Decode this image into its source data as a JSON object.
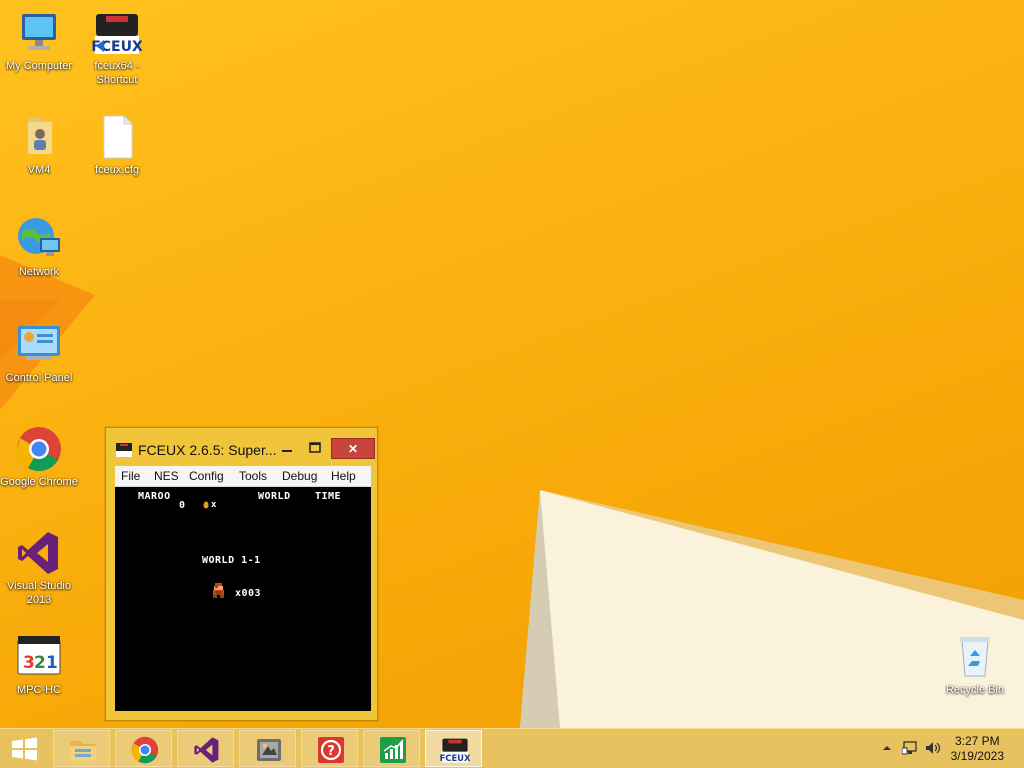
{
  "desktop": {
    "icons": [
      {
        "label": "My Computer",
        "icon": "computer-icon"
      },
      {
        "label": "fceux64 - Shortcut",
        "icon": "fceux-icon"
      },
      {
        "label": "VM4",
        "icon": "folder-icon"
      },
      {
        "label": "fceux.cfg",
        "icon": "file-icon"
      },
      {
        "label": "Network",
        "icon": "network-icon"
      },
      {
        "label": "Control Panel",
        "icon": "control-panel-icon"
      },
      {
        "label": "Google Chrome",
        "icon": "chrome-icon"
      },
      {
        "label": "Visual Studio 2013",
        "icon": "visual-studio-icon"
      },
      {
        "label": "MPC-HC",
        "icon": "mpc-hc-icon"
      },
      {
        "label": "Recycle Bin",
        "icon": "recycle-bin-icon"
      }
    ]
  },
  "window": {
    "title": "FCEUX 2.6.5: Super...",
    "close_glyph": "✕",
    "menu": [
      "File",
      "NES",
      "Config",
      "Tools",
      "Debug",
      "Help"
    ],
    "game": {
      "player_name": "MAROO",
      "score": "0",
      "coin_x": "x",
      "world_header": "WORLD",
      "time_header": "TIME",
      "world_title": "WORLD 1-1",
      "lives": "x003"
    }
  },
  "taskbar": {
    "items": [
      "start-icon",
      "file-explorer-icon",
      "chrome-icon",
      "visual-studio-icon",
      "app-icon",
      "help-icon",
      "chart-icon",
      "fceux-icon"
    ],
    "clock_time": "3:27 PM",
    "clock_date": "3/19/2023"
  },
  "colors": {
    "accent": "#f6a807",
    "close_button": "#c7443a",
    "taskbar": "#e8c25e"
  }
}
